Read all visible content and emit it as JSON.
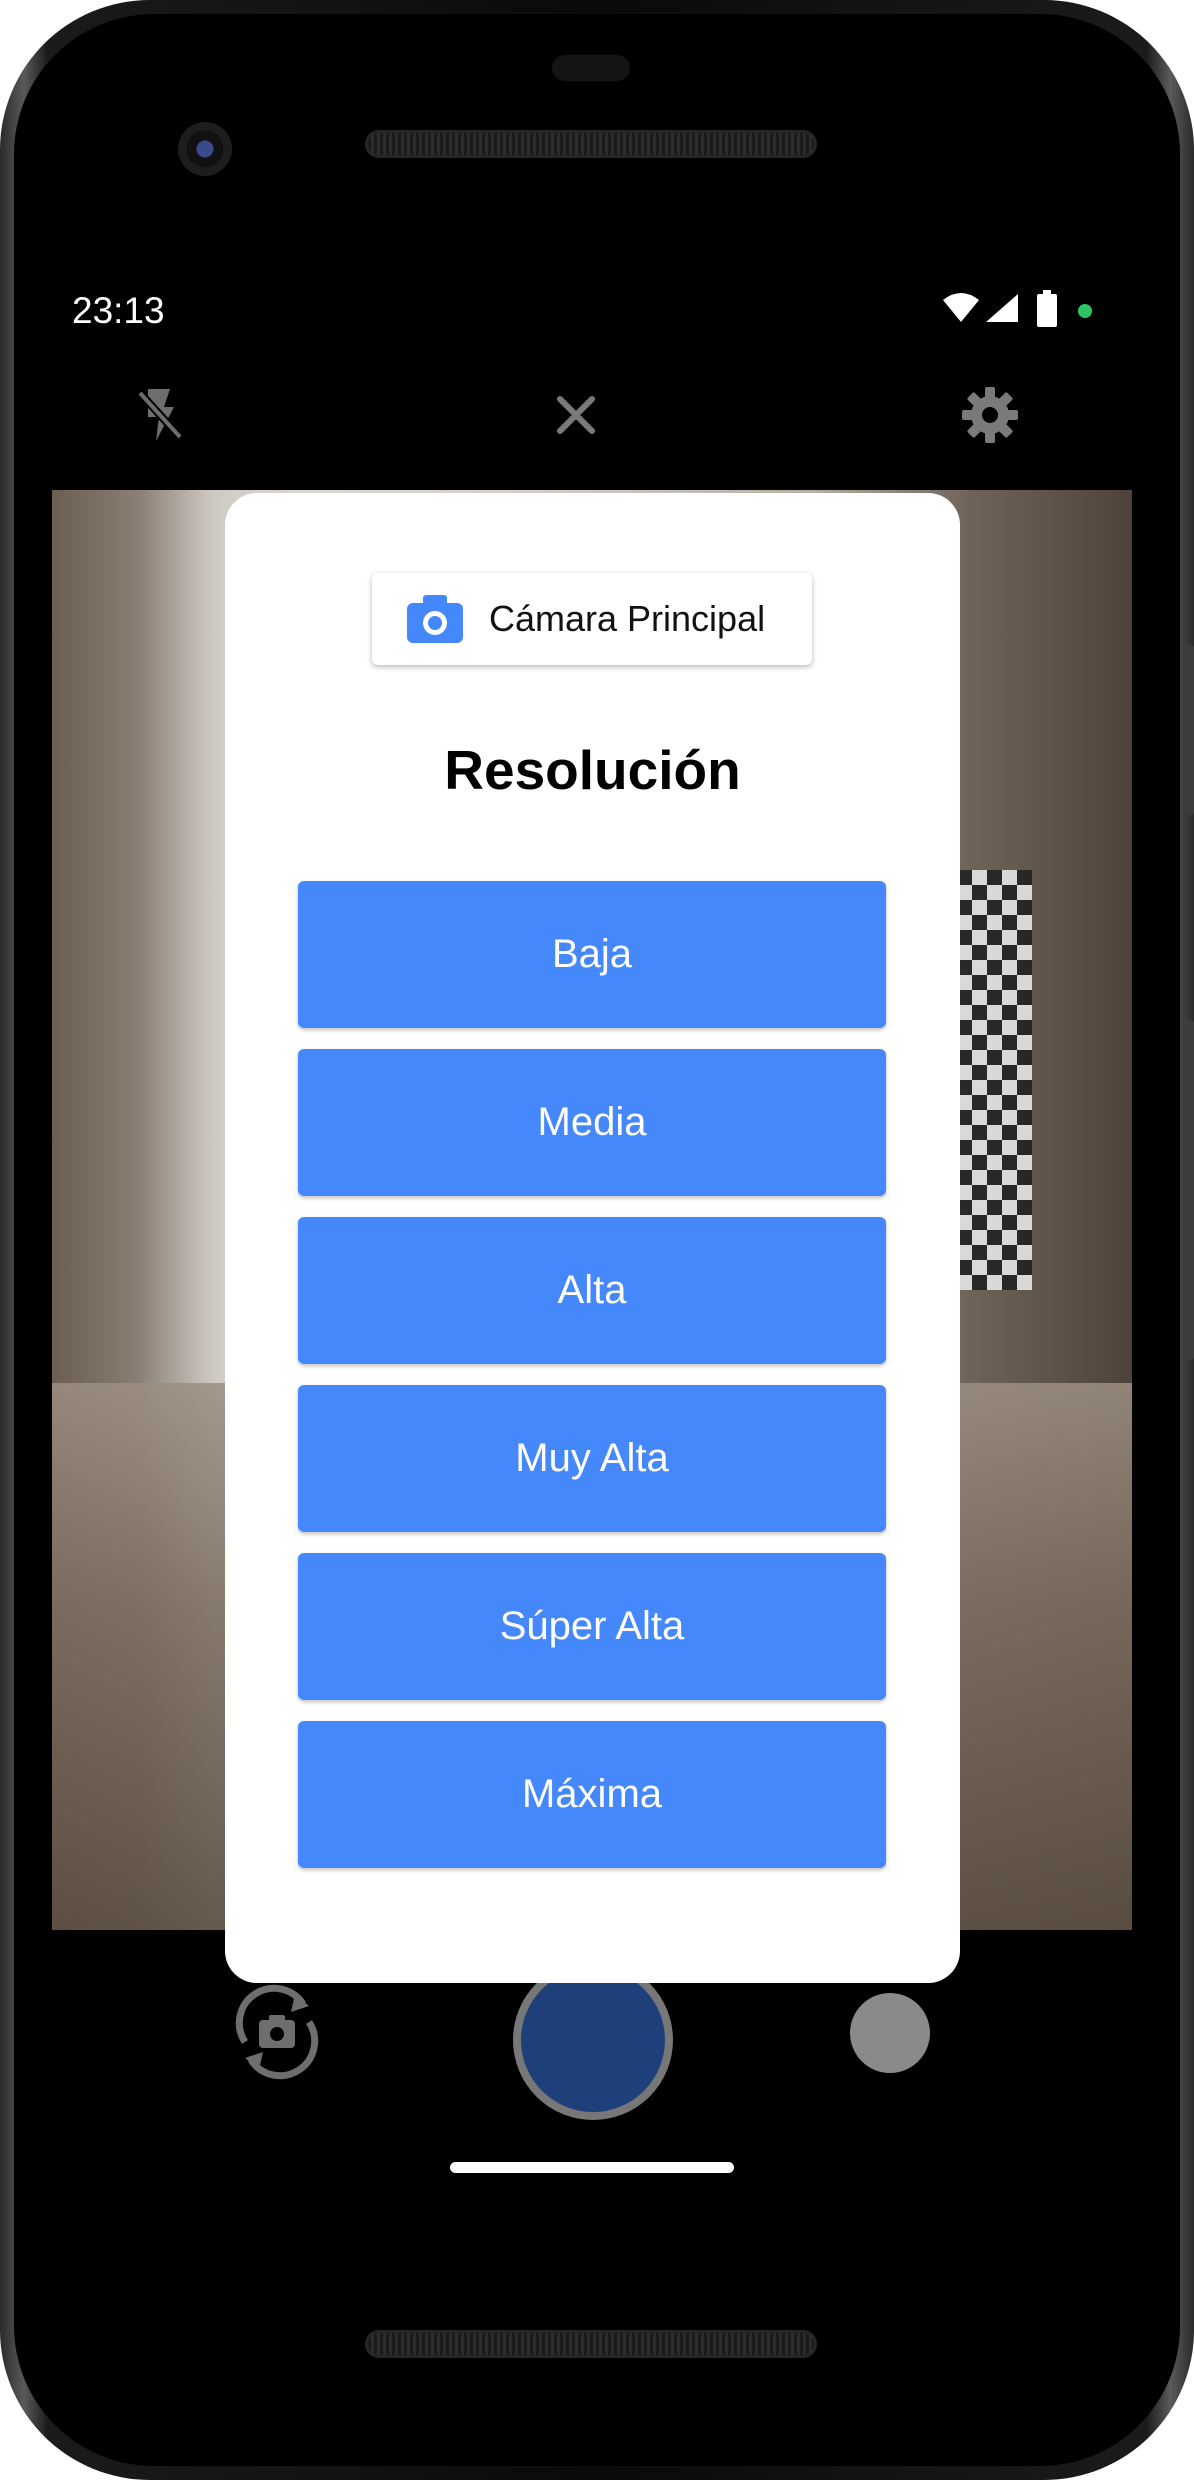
{
  "status_bar": {
    "time": "23:13",
    "icons": [
      "wifi-icon",
      "signal-icon",
      "battery-icon",
      "notification-dot"
    ]
  },
  "camera_toolbar": {
    "left_icon": "flash-off-icon",
    "center_icon": "close-icon",
    "right_icon": "gear-icon"
  },
  "modal": {
    "camera_selector": {
      "icon": "camera-icon",
      "label": "Cámara Principal"
    },
    "title": "Resolución",
    "options": [
      {
        "label": "Baja"
      },
      {
        "label": "Media"
      },
      {
        "label": "Alta"
      },
      {
        "label": "Muy Alta"
      },
      {
        "label": "Súper Alta"
      },
      {
        "label": "Máxima"
      }
    ]
  },
  "bottom_controls": {
    "left_icon": "switch-camera-icon",
    "center": "shutter-button",
    "right": "gallery-thumbnail"
  },
  "colors": {
    "accent": "#4488fc",
    "shutter": "#1e3f7a",
    "status_dot": "#2ec463"
  }
}
